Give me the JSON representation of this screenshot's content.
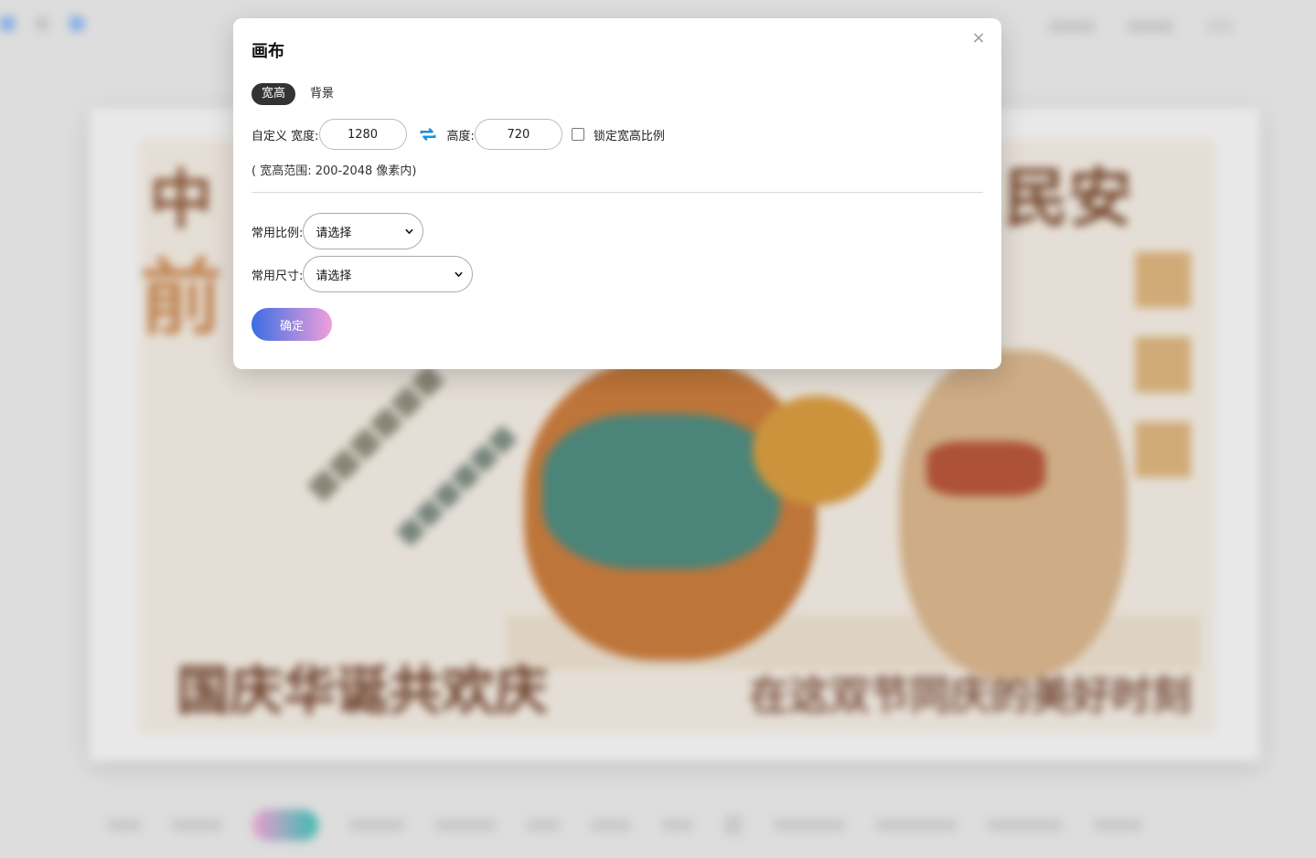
{
  "modal": {
    "title": "画布",
    "close_symbol": "×",
    "tabs": [
      {
        "label": "宽高",
        "active": true
      },
      {
        "label": "背景",
        "active": false
      }
    ],
    "size": {
      "custom_label": "自定义 宽度:",
      "width_value": "1280",
      "height_label": "高度:",
      "height_value": "720",
      "lock_ratio_label": "锁定宽高比例",
      "lock_ratio_checked": false,
      "range_note": "( 宽高范围: 200-2048 像素内)"
    },
    "common_ratio": {
      "label": "常用比例:",
      "selected": "请选择"
    },
    "common_size": {
      "label": "常用尺寸:",
      "selected": "请选择"
    },
    "confirm_label": "确定"
  },
  "background_app": {
    "wordcloud_words": [
      "中",
      "民安",
      "国庆华诞共欢庆",
      "在这双节同庆的美好时刻",
      "前"
    ]
  },
  "colors": {
    "active_tab": "#333333",
    "swap_icon": "#1a8fe3",
    "confirm_gradient_start": "#3b6ee3",
    "confirm_gradient_end": "#f09fdc"
  },
  "icons": {
    "close": "close-icon",
    "swap": "swap-icon",
    "select_chevron": "chevron-down-icon"
  }
}
